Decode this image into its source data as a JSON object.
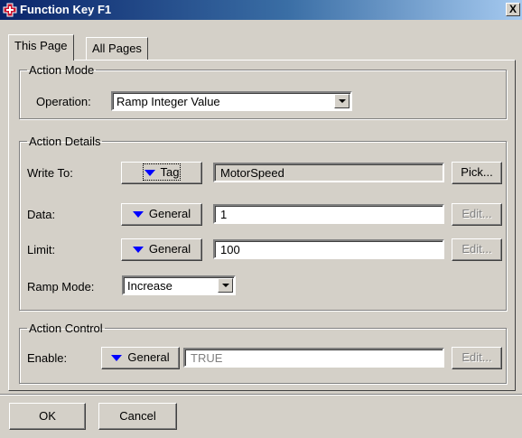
{
  "window": {
    "title": "Function Key F1",
    "close_label": "X"
  },
  "tabs": [
    {
      "label": "This Page"
    },
    {
      "label": "All Pages"
    }
  ],
  "action_mode": {
    "legend": "Action Mode",
    "operation_label": "Operation:",
    "operation_value": "Ramp Integer Value"
  },
  "action_details": {
    "legend": "Action Details",
    "write_to": {
      "label": "Write To:",
      "source": "Tag",
      "value": "MotorSpeed",
      "button": "Pick..."
    },
    "data": {
      "label": "Data:",
      "source": "General",
      "value": "1",
      "button": "Edit..."
    },
    "limit": {
      "label": "Limit:",
      "source": "General",
      "value": "100",
      "button": "Edit..."
    },
    "ramp_mode": {
      "label": "Ramp Mode:",
      "value": "Increase"
    }
  },
  "action_control": {
    "legend": "Action Control",
    "enable": {
      "label": "Enable:",
      "source": "General",
      "value": "TRUE",
      "button": "Edit..."
    }
  },
  "footer": {
    "ok_label": "OK",
    "cancel_label": "Cancel"
  },
  "colors": {
    "title_start": "#0a246a",
    "title_end": "#a6caf0",
    "face": "#d4d0c8",
    "source_arrow": "#0000ff",
    "icon_red": "#c8102e"
  }
}
